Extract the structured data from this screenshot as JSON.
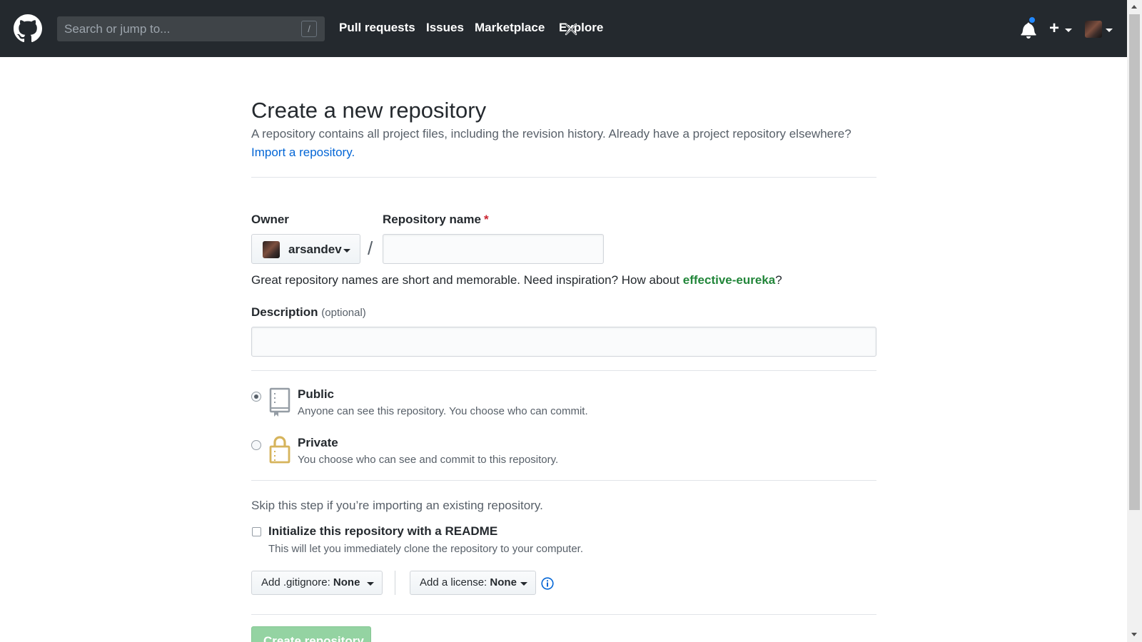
{
  "header": {
    "search_placeholder": "Search or jump to...",
    "search_shortcut": "/",
    "nav": [
      {
        "label": "Pull requests"
      },
      {
        "label": "Issues"
      },
      {
        "label": "Marketplace"
      },
      {
        "label": "Explore"
      }
    ],
    "plus_label": "+",
    "notification_indicator_color": "#2188ff"
  },
  "page": {
    "title": "Create a new repository",
    "subtitle": "A repository contains all project files, including the revision history. Already have a project repository elsewhere?",
    "import_link": "Import a repository."
  },
  "form": {
    "owner_label": "Owner",
    "owner_value": "arsandev",
    "separator": "/",
    "repo_name_label": "Repository name",
    "required_marker": "*",
    "repo_name_value": "",
    "hint_text": "Great repository names are short and memorable. Need inspiration? How about ",
    "hint_suggestion": "effective-eureka",
    "hint_end": "?",
    "description_label": "Description",
    "description_optional": "(optional)",
    "description_value": "",
    "visibility": [
      {
        "title": "Public",
        "desc": "Anyone can see this repository. You choose who can commit.",
        "selected": true
      },
      {
        "title": "Private",
        "desc": "You choose who can see and commit to this repository.",
        "selected": false
      }
    ],
    "skip_text": "Skip this step if you’re importing an existing repository.",
    "readme_label": "Initialize this repository with a README",
    "readme_desc": "This will let you immediately clone the repository to your computer.",
    "gitignore_prefix": "Add .gitignore:",
    "gitignore_value": "None",
    "license_prefix": "Add a license:",
    "license_value": "None",
    "submit_label": "Create repository"
  },
  "colors": {
    "header_bg": "#24292e",
    "link": "#0366d6",
    "suggestion": "#22863a",
    "submit_disabled": "#94d3a2"
  }
}
